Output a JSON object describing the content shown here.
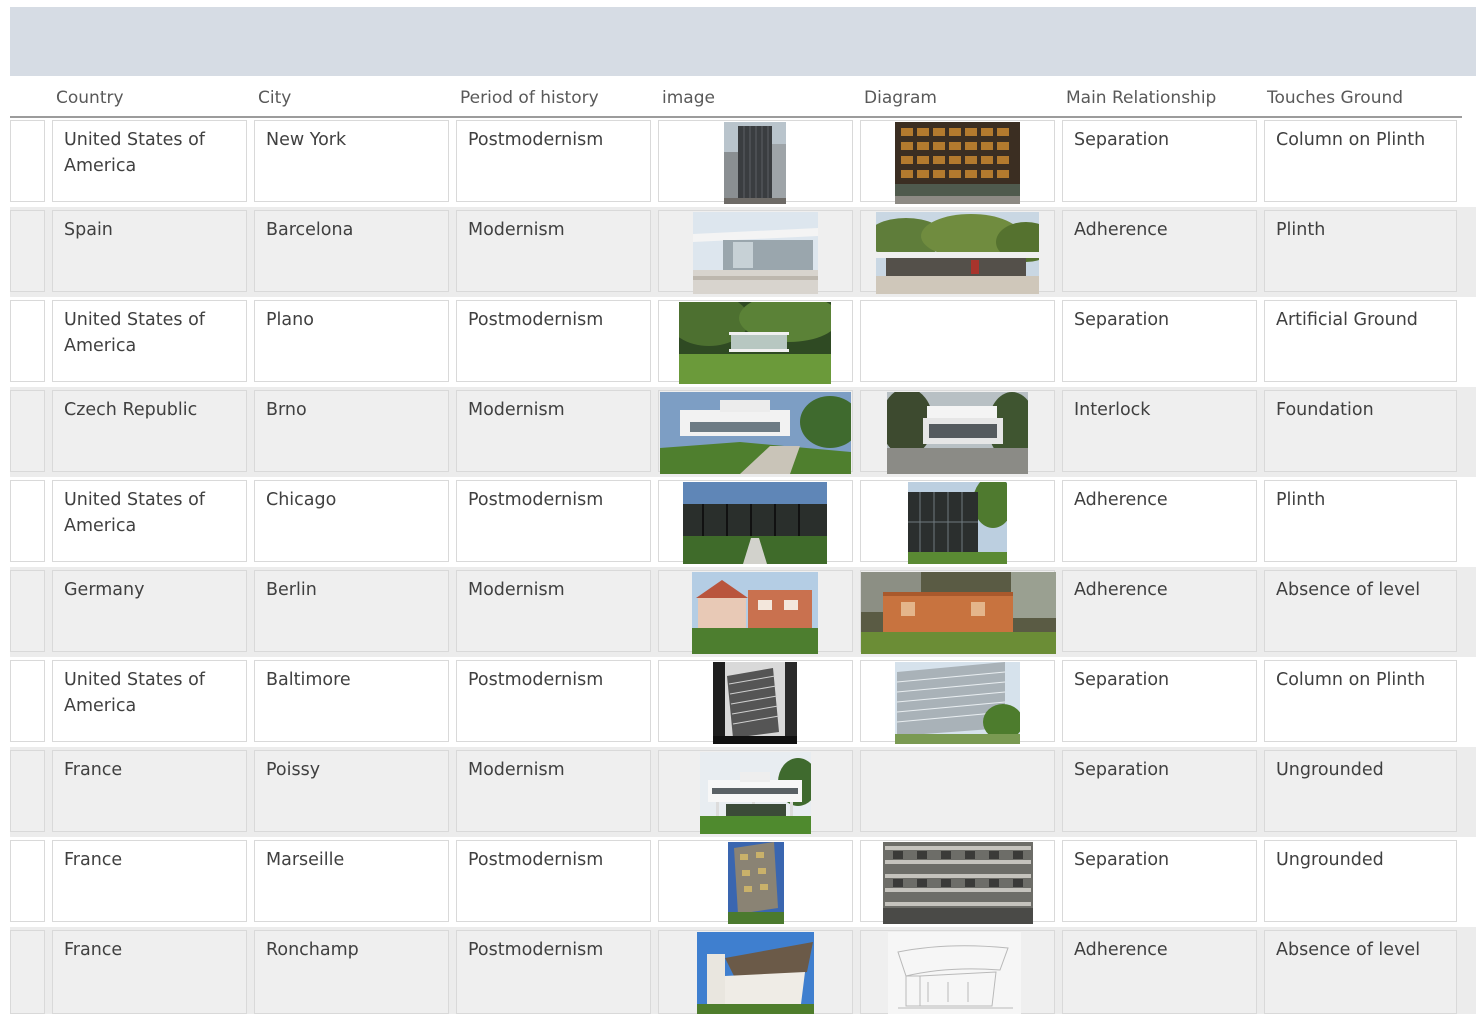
{
  "headers": {
    "country": "Country",
    "city": "City",
    "period": "Period of history",
    "image": "image",
    "diagram": "Diagram",
    "relationship": "Main Relationship",
    "ground": "Touches Ground"
  },
  "rows": [
    {
      "country": "United States of America",
      "city": "New York",
      "period": "Postmodernism",
      "relationship": "Separation",
      "ground": "Column on Plinth",
      "image": "skyscraper-photo",
      "diagram": "facade-photo"
    },
    {
      "country": "Spain",
      "city": "Barcelona",
      "period": "Modernism",
      "relationship": "Adherence",
      "ground": "Plinth",
      "image": "pavilion-photo",
      "diagram": "pavilion-garden-photo"
    },
    {
      "country": "United States of America",
      "city": "Plano",
      "period": "Postmodernism",
      "relationship": "Separation",
      "ground": "Artificial Ground",
      "image": "glass-house-photo",
      "diagram": ""
    },
    {
      "country": "Czech Republic",
      "city": "Brno",
      "period": "Modernism",
      "relationship": "Interlock",
      "ground": "Foundation",
      "image": "white-villa-photo",
      "diagram": "villa-sketch-photo"
    },
    {
      "country": "United States of America",
      "city": "Chicago",
      "period": "Postmodernism",
      "relationship": "Adherence",
      "ground": "Plinth",
      "image": "steel-hall-photo",
      "diagram": "steel-facade-photo"
    },
    {
      "country": "Germany",
      "city": "Berlin",
      "period": "Modernism",
      "relationship": "Adherence",
      "ground": "Absence of level",
      "image": "brick-house-photo",
      "diagram": "brick-villa-photo"
    },
    {
      "country": "United States of America",
      "city": "Baltimore",
      "period": "Postmodernism",
      "relationship": "Separation",
      "ground": "Column on Plinth",
      "image": "bw-tower-photo",
      "diagram": "tower-photo"
    },
    {
      "country": "France",
      "city": "Poissy",
      "period": "Modernism",
      "relationship": "Separation",
      "ground": "Ungrounded",
      "image": "villa-savoye-photo",
      "diagram": ""
    },
    {
      "country": "France",
      "city": "Marseille",
      "period": "Postmodernism",
      "relationship": "Separation",
      "ground": "Ungrounded",
      "image": "unite-tower-photo",
      "diagram": "unite-facade-photo"
    },
    {
      "country": "France",
      "city": "Ronchamp",
      "period": "Postmodernism",
      "relationship": "Adherence",
      "ground": "Absence of level",
      "image": "chapel-photo",
      "diagram": "chapel-sketch"
    }
  ]
}
